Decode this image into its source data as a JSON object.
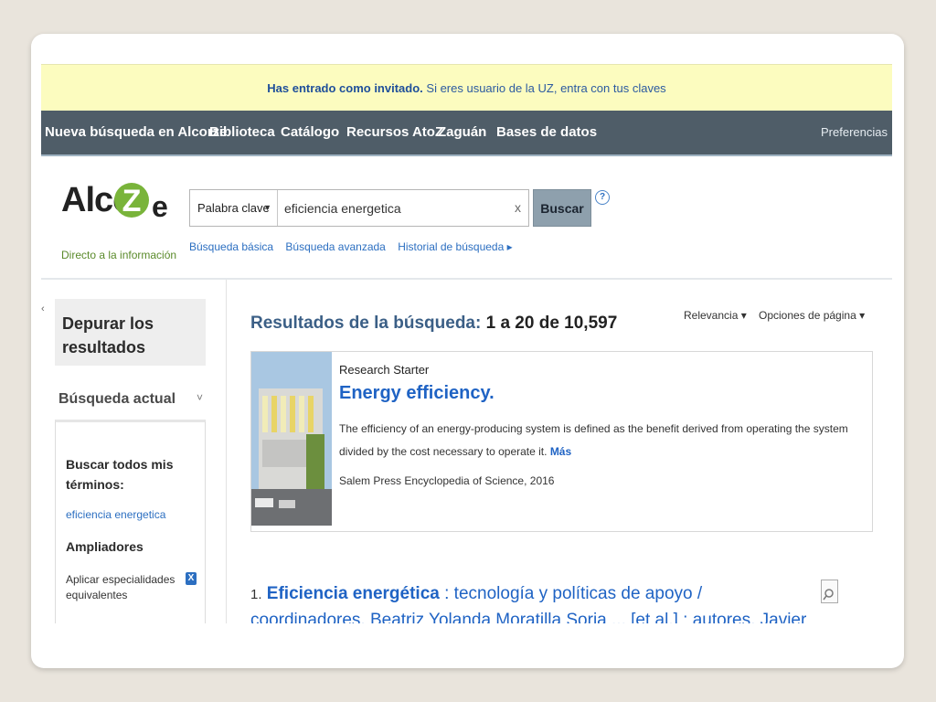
{
  "banner": {
    "bold": "Has entrado como invitado.",
    "text": " Si eres usuario de la UZ, entra con tus claves"
  },
  "nav": {
    "items": [
      "Nueva búsqueda en Alcorze",
      "Biblioteca",
      "Catálogo",
      "Recursos AtoZ",
      "Zaguán",
      "Bases de datos"
    ],
    "preferences": "Preferencias"
  },
  "logo": {
    "alcor": "Alcor",
    "z": "Z",
    "e": "e",
    "tagline": "Directo a la información"
  },
  "search": {
    "field_label": "Palabra clave",
    "query": "eficiencia energetica",
    "clear": "x",
    "button": "Buscar",
    "help": "?",
    "links": [
      "Búsqueda básica",
      "Búsqueda avanzada",
      "Historial de búsqueda ▸"
    ]
  },
  "sidebar": {
    "collapse": "‹",
    "refine_title": "Depurar los resultados",
    "current_title": "Búsqueda actual",
    "current_caret": "˅",
    "all_terms_label": "Buscar todos mis términos:",
    "all_terms_value": "eficiencia energetica",
    "expanders_title": "Ampliadores",
    "expander_label": "Aplicar especialidades equivalentes",
    "expander_remove": "X"
  },
  "results": {
    "heading_label": "Resultados de la búsqueda:",
    "heading_count": "1 a 20 de 10,597",
    "sort_label": "Relevancia ▾",
    "page_options": "Opciones de página ▾",
    "starter": {
      "type": "Research Starter",
      "title": "Energy efficiency.",
      "description": "The efficiency of an energy-producing system is defined as the benefit derived from operating the system divided by the cost necessary to operate it.",
      "more": "Más",
      "source": "Salem Press Encyclopedia of Science, 2016"
    },
    "items": [
      {
        "number": "1.",
        "title": "Eficiencia energética",
        "rest": " : tecnología y políticas de apoyo / coordinadores, Beatriz Yolanda Moratilla Soria ... [et al.] ; autores, Javier Abadía Pérez ... [et al.]"
      }
    ]
  }
}
